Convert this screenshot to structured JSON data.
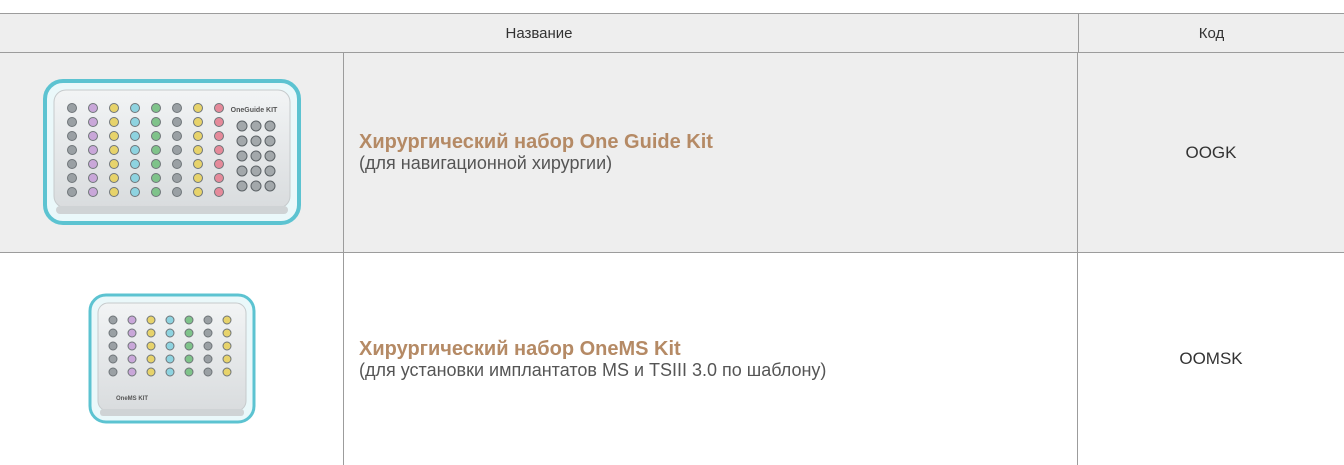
{
  "table": {
    "header": {
      "name": "Название",
      "code": "Код"
    },
    "rows": [
      {
        "title": "Хирургический набор One Guide Kit",
        "subtitle": "(для навигационной хирургии)",
        "code": "OOGK",
        "image_icon": "surgical-kit-tray"
      },
      {
        "title": "Хирургический набор OneMS Kit",
        "subtitle": "(для установки имплантатов MS и TSIII 3.0 по шаблону)",
        "code": "OOMSK",
        "image_icon": "surgical-kit-tray"
      }
    ]
  },
  "colors": {
    "title": "#b58a65",
    "tray_border": "#5cc3d1",
    "header_bg": "#eeeeee"
  }
}
